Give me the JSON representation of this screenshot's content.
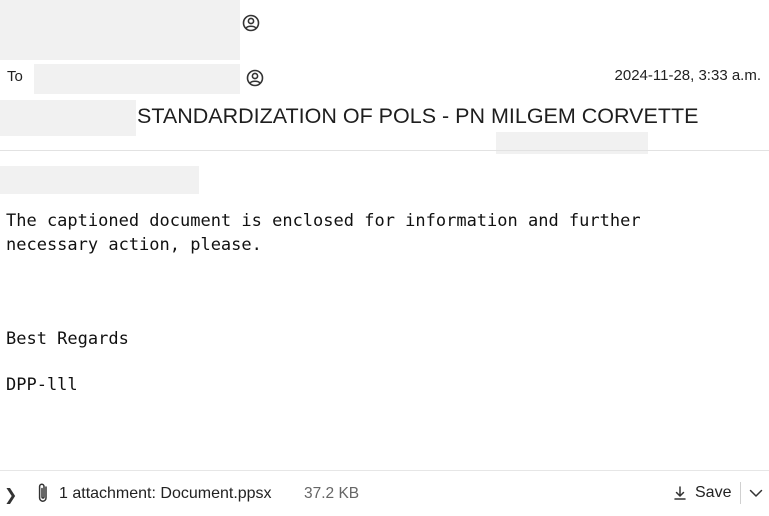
{
  "header": {
    "to_label": "To",
    "date": "2024-11-28, 3:33 a.m.",
    "subject": "STANDARDIZATION OF POLS - PN MILGEM CORVETTE"
  },
  "body": {
    "lines": [
      "The captioned document is enclosed for information and further",
      "necessary action, please."
    ],
    "closing": "Best Regards",
    "signature": "DPP-lll"
  },
  "footer": {
    "attachment_label": "1 attachment: Document.ppsx",
    "attachment_size": "37.2 KB",
    "save_label": "Save"
  },
  "icons": {
    "sender": "person-circle-icon",
    "recipient": "person-circle-icon",
    "expand": "chevron-right-icon",
    "attachment": "paperclip-icon",
    "save": "download-icon",
    "more": "chevron-down-icon"
  }
}
